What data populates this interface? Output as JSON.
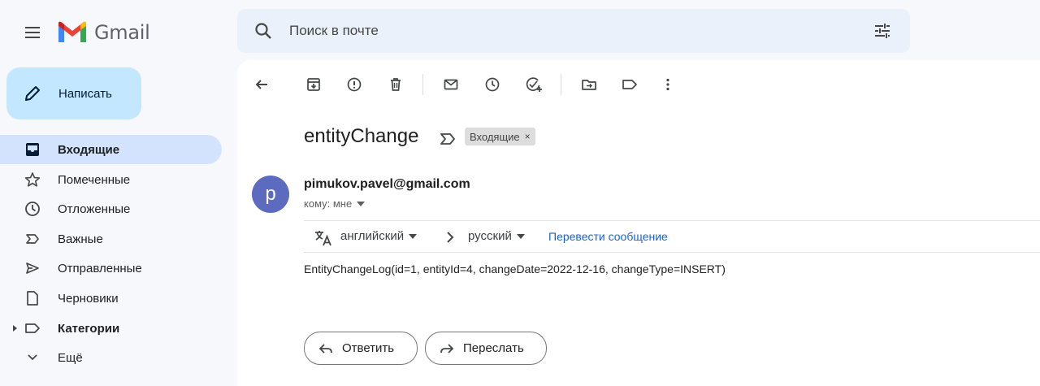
{
  "app": {
    "name": "Gmail"
  },
  "search": {
    "placeholder": "Поиск в почте"
  },
  "compose": {
    "label": "Написать"
  },
  "sidebar": {
    "items": [
      {
        "label": "Входящие",
        "icon": "inbox-icon",
        "active": true
      },
      {
        "label": "Помеченные",
        "icon": "star-icon"
      },
      {
        "label": "Отложенные",
        "icon": "clock-icon"
      },
      {
        "label": "Важные",
        "icon": "important-icon"
      },
      {
        "label": "Отправленные",
        "icon": "send-icon"
      },
      {
        "label": "Черновики",
        "icon": "draft-icon"
      },
      {
        "label": "Категории",
        "icon": "label-icon",
        "bold": true
      },
      {
        "label": "Ещё",
        "icon": "chevron-down-icon"
      }
    ]
  },
  "toolbar": {
    "icons": [
      "back-icon",
      "archive-icon",
      "report-spam-icon",
      "delete-icon",
      "mark-unread-icon",
      "snooze-icon",
      "add-task-icon",
      "move-to-icon",
      "labels-icon",
      "more-icon"
    ]
  },
  "message": {
    "subject": "entityChange",
    "label_chip": "Входящие",
    "chip_close": "×",
    "avatar_letter": "p",
    "sender": "pimukov.pavel@gmail.com",
    "recipient": "кому: мне",
    "body": "EntityChangeLog(id=1, entityId=4, changeDate=2022-12-16, changeType=INSERT)"
  },
  "translate": {
    "source_lang": "английский",
    "target_lang": "русский",
    "link": "Перевести сообщение"
  },
  "actions": {
    "reply": "Ответить",
    "forward": "Переслать"
  },
  "colors": {
    "accent": "#c2e7ff",
    "active_nav": "#d3e3fd",
    "avatar": "#5c6bc0",
    "link": "#1a62d6"
  }
}
